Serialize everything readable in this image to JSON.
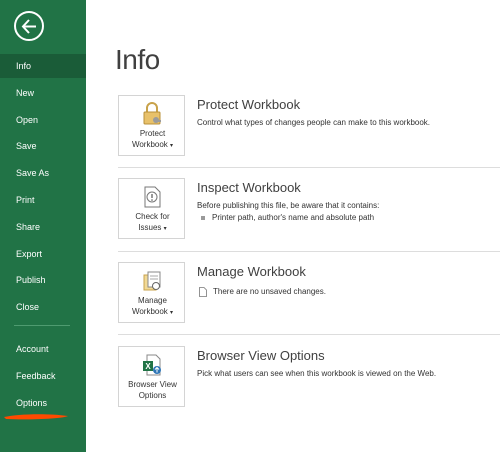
{
  "sidebar": {
    "back_icon": "back-arrow-icon",
    "items": [
      {
        "label": "Info"
      },
      {
        "label": "New"
      },
      {
        "label": "Open"
      },
      {
        "label": "Save"
      },
      {
        "label": "Save As"
      },
      {
        "label": "Print"
      },
      {
        "label": "Share"
      },
      {
        "label": "Export"
      },
      {
        "label": "Publish"
      },
      {
        "label": "Close"
      }
    ],
    "footer_items": [
      {
        "label": "Account"
      },
      {
        "label": "Feedback"
      },
      {
        "label": "Options"
      }
    ],
    "colors": {
      "background": "#217346",
      "active": "#1a5c38",
      "annotation": "#ff4a00"
    }
  },
  "main": {
    "title": "Info",
    "sections": [
      {
        "tile_line1": "Protect",
        "tile_line2": "Workbook",
        "icon": "lock-key-icon",
        "title": "Protect Workbook",
        "description": "Control what types of changes people can make to this workbook."
      },
      {
        "tile_line1": "Check for",
        "tile_line2": "Issues",
        "icon": "check-issues-icon",
        "title": "Inspect Workbook",
        "description": "Before publishing this file, be aware that it contains:",
        "bullet": "Printer path, author's name and absolute path"
      },
      {
        "tile_line1": "Manage",
        "tile_line2": "Workbook",
        "icon": "manage-workbook-icon",
        "title": "Manage Workbook",
        "note": "There are no unsaved changes."
      },
      {
        "tile_line1": "Browser View",
        "tile_line2": "Options",
        "icon": "browser-view-icon",
        "title": "Browser View Options",
        "description": "Pick what users can see when this workbook is viewed on the Web."
      }
    ]
  }
}
